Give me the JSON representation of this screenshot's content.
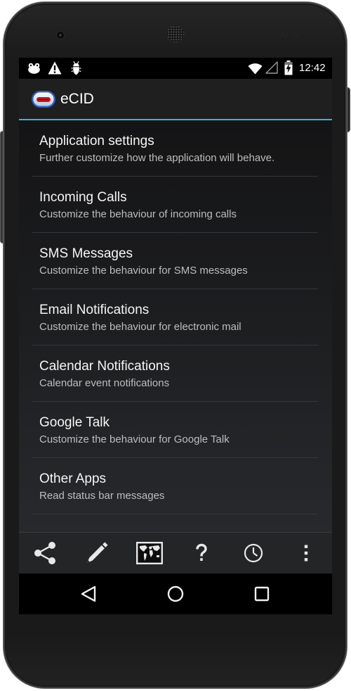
{
  "status_bar": {
    "time": "12:42",
    "notification_icons": [
      "frog-notification-icon",
      "warning-icon",
      "usb-debugging-icon"
    ],
    "system_icons": [
      "wifi-icon",
      "signal-icon",
      "battery-charging-icon"
    ]
  },
  "action_bar": {
    "app_icon": "ecid-app-icon",
    "title": "eCID"
  },
  "settings": {
    "items": [
      {
        "title": "Application settings",
        "summary": "Further customize how the application will behave."
      },
      {
        "title": "Incoming Calls",
        "summary": "Customize the behaviour of incoming calls"
      },
      {
        "title": "SMS Messages",
        "summary": "Customize the behaviour for SMS messages"
      },
      {
        "title": "Email Notifications",
        "summary": "Customize the behaviour for electronic mail"
      },
      {
        "title": "Calendar Notifications",
        "summary": "Calendar event notifications"
      },
      {
        "title": "Google Talk",
        "summary": "Customize the behaviour for Google Talk"
      },
      {
        "title": "Other Apps",
        "summary": "Read status bar messages"
      }
    ]
  },
  "bottom_action_bar": {
    "icons": [
      "share-icon",
      "pencil-icon",
      "map-icon",
      "help-icon",
      "clock-icon",
      "overflow-menu-icon"
    ]
  },
  "navigation_bar": {
    "icons": [
      "back-icon",
      "home-icon",
      "recents-icon"
    ]
  },
  "colors": {
    "accent": "#33b5e5",
    "title_text": "#f5f5f5",
    "summary_text": "#bdbdbd"
  }
}
